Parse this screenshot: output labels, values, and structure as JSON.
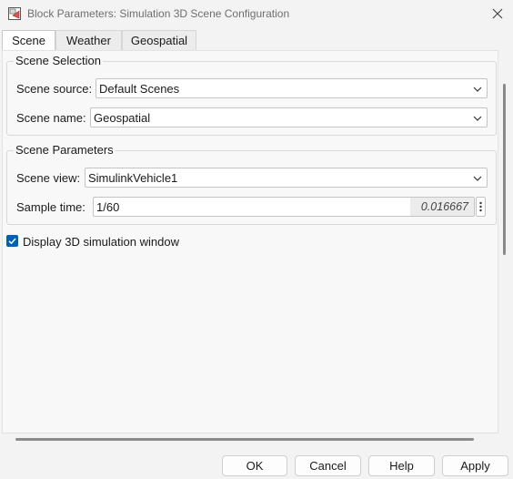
{
  "window": {
    "title": "Block Parameters: Simulation 3D Scene Configuration",
    "icon": "block-parameters-icon",
    "close_icon": "close-icon"
  },
  "tabs": [
    {
      "label": "Scene",
      "active": true
    },
    {
      "label": "Weather",
      "active": false
    },
    {
      "label": "Geospatial",
      "active": false
    }
  ],
  "scene_selection": {
    "title": "Scene Selection",
    "source_label": "Scene source:",
    "source_value": "Default Scenes",
    "name_label": "Scene name:",
    "name_value": "Geospatial"
  },
  "scene_parameters": {
    "title": "Scene Parameters",
    "view_label": "Scene view:",
    "view_value": "SimulinkVehicle1",
    "sample_label": "Sample time:",
    "sample_value": "1/60",
    "sample_evaluated": "0.016667"
  },
  "display_window": {
    "label": "Display 3D simulation window",
    "checked": true
  },
  "buttons": {
    "ok": "OK",
    "cancel": "Cancel",
    "help": "Help",
    "apply": "Apply"
  },
  "colors": {
    "accent": "#005fb8",
    "background": "#f3f3f3"
  }
}
